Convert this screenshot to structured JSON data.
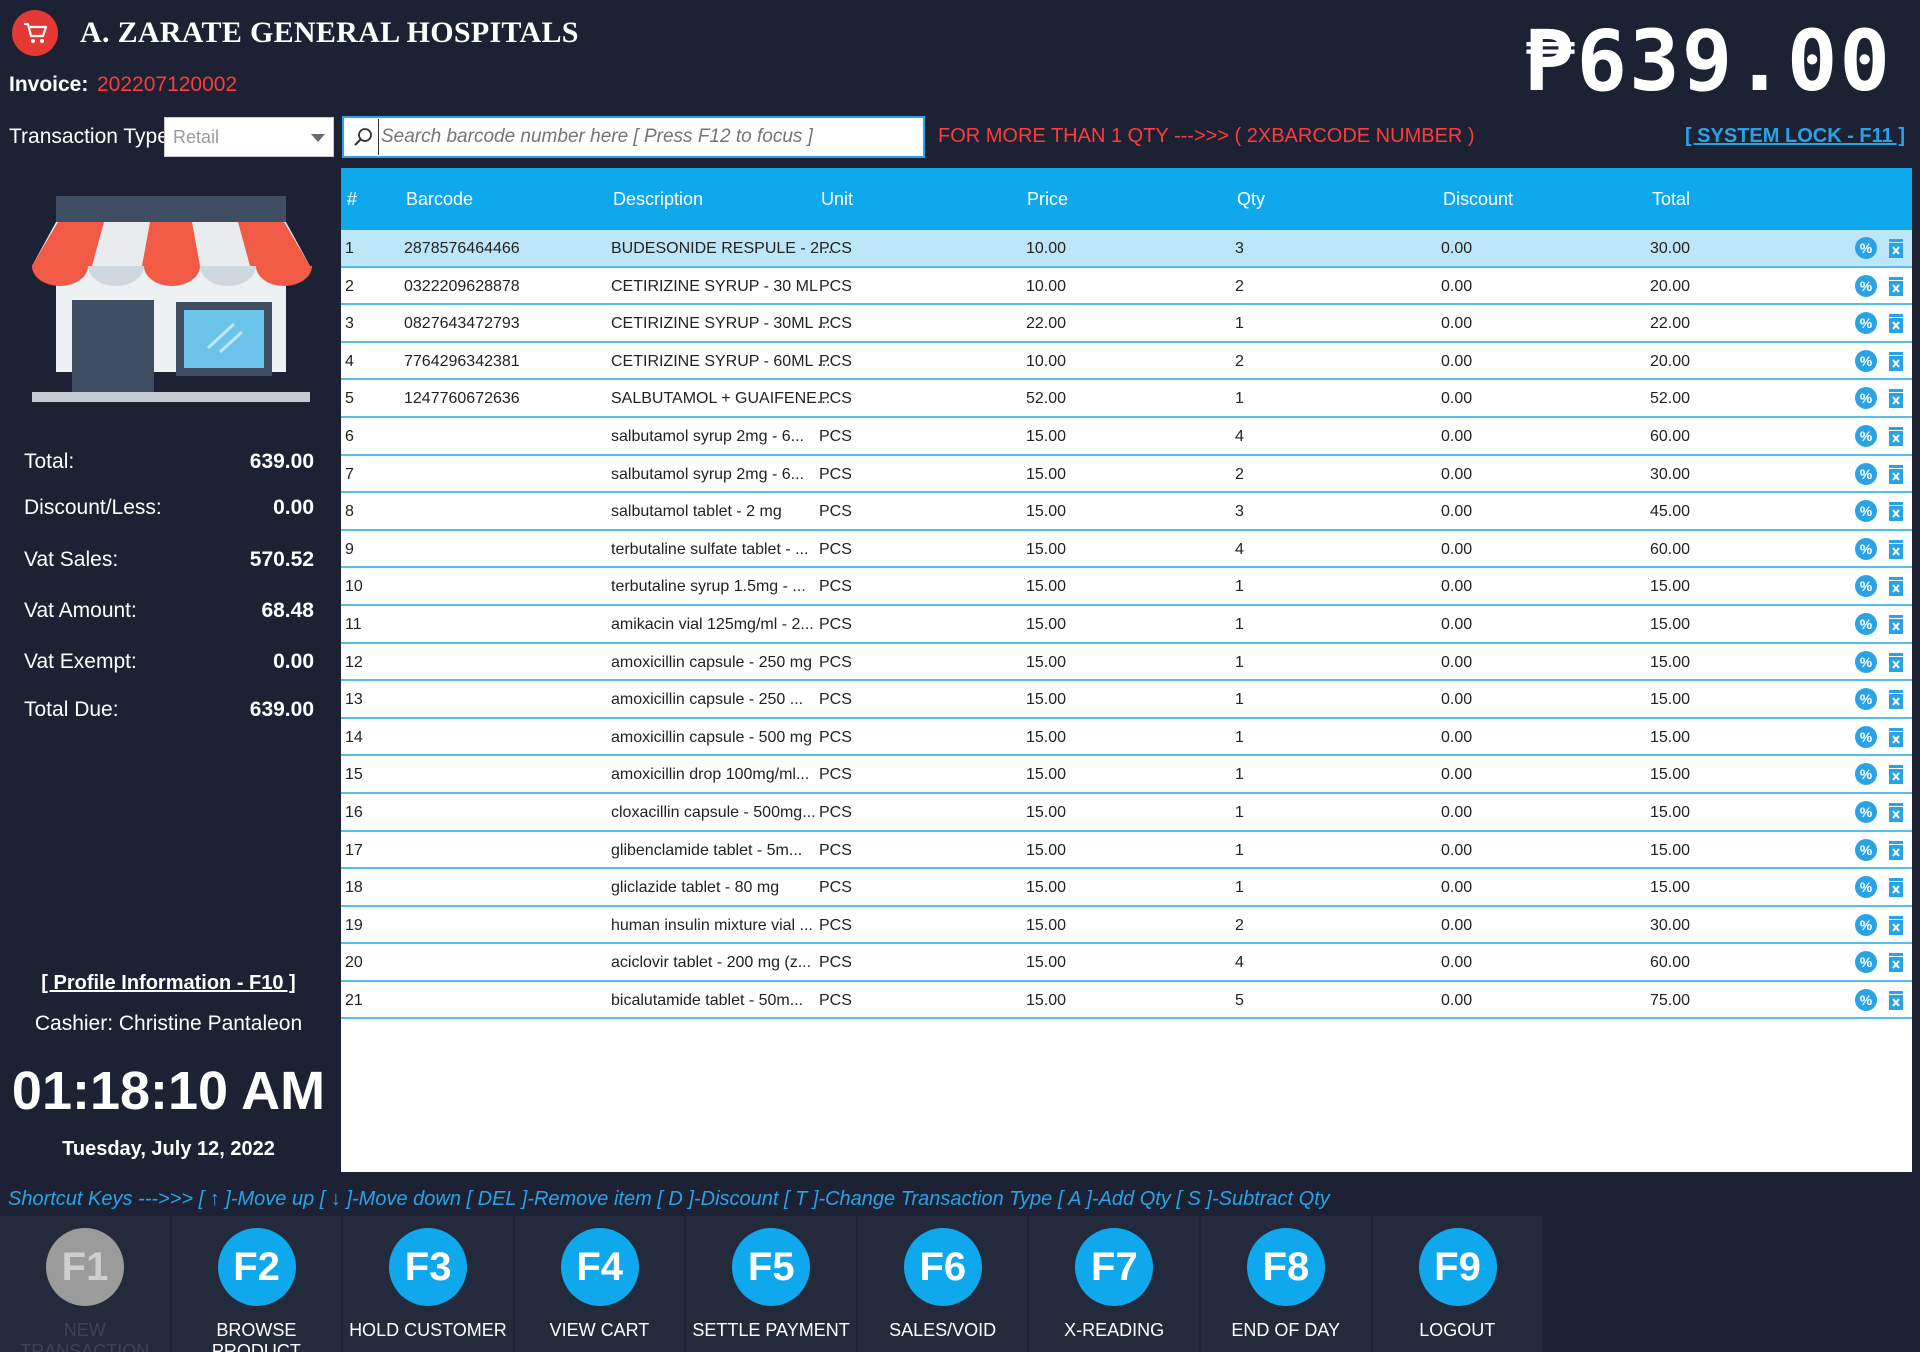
{
  "header": {
    "hospital_name": "A. ZARATE GENERAL HOSPITALS",
    "invoice_label": "Invoice:",
    "invoice_number": "202207120002",
    "big_total": "₱639.00",
    "transaction_type_label": "Transaction Type:",
    "transaction_type_value": "Retail",
    "search_placeholder": "Search barcode number here [ Press F12 to focus ]",
    "qty_hint": "FOR MORE THAN 1 QTY --->>> ( 2XBARCODE NUMBER )",
    "system_lock": "[ SYSTEM LOCK - F11 ]"
  },
  "summary": [
    {
      "label": "Total:",
      "value": "639.00"
    },
    {
      "label": "Discount/Less:",
      "value": "0.00"
    },
    {
      "label": "Vat Sales:",
      "value": "570.52"
    },
    {
      "label": "Vat Amount:",
      "value": "68.48"
    },
    {
      "label": "Vat Exempt:",
      "value": "0.00"
    },
    {
      "label": "Total Due:",
      "value": "639.00"
    }
  ],
  "profile": {
    "link": "[ Profile Information - F10 ]",
    "cashier": "Cashier: Christine Pantaleon",
    "time": "01:18:10 AM",
    "date": "Tuesday, July 12, 2022"
  },
  "table": {
    "columns": [
      "#",
      "Barcode",
      "Description",
      "Unit",
      "Price",
      "Qty",
      "Discount",
      "Total"
    ],
    "rows": [
      [
        "1",
        "2878576464466",
        "BUDESONIDE RESPULE - 2...",
        "PCS",
        "10.00",
        "3",
        "0.00",
        "30.00"
      ],
      [
        "2",
        "0322209628878",
        "CETIRIZINE SYRUP - 30 ML",
        "PCS",
        "10.00",
        "2",
        "0.00",
        "20.00"
      ],
      [
        "3",
        "0827643472793",
        "CETIRIZINE SYRUP - 30ML ...",
        "PCS",
        "22.00",
        "1",
        "0.00",
        "22.00"
      ],
      [
        "4",
        "7764296342381",
        "CETIRIZINE SYRUP - 60ML ...",
        "PCS",
        "10.00",
        "2",
        "0.00",
        "20.00"
      ],
      [
        "5",
        "1247760672636",
        "SALBUTAMOL + GUAIFENE...",
        "PCS",
        "52.00",
        "1",
        "0.00",
        "52.00"
      ],
      [
        "6",
        "",
        "salbutamol syrup 2mg - 6...",
        "PCS",
        "15.00",
        "4",
        "0.00",
        "60.00"
      ],
      [
        "7",
        "",
        "salbutamol syrup 2mg - 6...",
        "PCS",
        "15.00",
        "2",
        "0.00",
        "30.00"
      ],
      [
        "8",
        "",
        "salbutamol tablet - 2 mg",
        "PCS",
        "15.00",
        "3",
        "0.00",
        "45.00"
      ],
      [
        "9",
        "",
        "terbutaline sulfate tablet - ...",
        "PCS",
        "15.00",
        "4",
        "0.00",
        "60.00"
      ],
      [
        "10",
        "",
        "terbutaline syrup 1.5mg - ...",
        "PCS",
        "15.00",
        "1",
        "0.00",
        "15.00"
      ],
      [
        "11",
        "",
        "amikacin vial 125mg/ml - 2...",
        "PCS",
        "15.00",
        "1",
        "0.00",
        "15.00"
      ],
      [
        "12",
        "",
        "amoxicillin capsule - 250 mg",
        "PCS",
        "15.00",
        "1",
        "0.00",
        "15.00"
      ],
      [
        "13",
        "",
        "amoxicillin capsule - 250 ...",
        "PCS",
        "15.00",
        "1",
        "0.00",
        "15.00"
      ],
      [
        "14",
        "",
        "amoxicillin capsule - 500 mg",
        "PCS",
        "15.00",
        "1",
        "0.00",
        "15.00"
      ],
      [
        "15",
        "",
        "amoxicillin drop 100mg/ml...",
        "PCS",
        "15.00",
        "1",
        "0.00",
        "15.00"
      ],
      [
        "16",
        "",
        "cloxacillin capsule - 500mg...",
        "PCS",
        "15.00",
        "1",
        "0.00",
        "15.00"
      ],
      [
        "17",
        "",
        "glibenclamide tablet - 5m...",
        "PCS",
        "15.00",
        "1",
        "0.00",
        "15.00"
      ],
      [
        "18",
        "",
        "gliclazide tablet - 80 mg",
        "PCS",
        "15.00",
        "1",
        "0.00",
        "15.00"
      ],
      [
        "19",
        "",
        "human insulin mixture vial ...",
        "PCS",
        "15.00",
        "2",
        "0.00",
        "30.00"
      ],
      [
        "20",
        "",
        "aciclovir tablet - 200 mg (z...",
        "PCS",
        "15.00",
        "4",
        "0.00",
        "60.00"
      ],
      [
        "21",
        "",
        "bicalutamide tablet - 50m...",
        "PCS",
        "15.00",
        "5",
        "0.00",
        "75.00"
      ]
    ]
  },
  "shortcuts_text": "Shortcut Keys --->>> [ ↑ ]-Move up [ ↓ ]-Move down  [ DEL ]-Remove item [ D ]-Discount [ T ]-Change Transaction Type [ A ]-Add Qty [ S ]-Subtract Qty",
  "function_keys": [
    {
      "key": "F1",
      "label": "NEW TRANSACTION",
      "disabled": true
    },
    {
      "key": "F2",
      "label": "BROWSE PRODUCT",
      "disabled": false
    },
    {
      "key": "F3",
      "label": "HOLD CUSTOMER",
      "disabled": false
    },
    {
      "key": "F4",
      "label": "VIEW CART",
      "disabled": false
    },
    {
      "key": "F5",
      "label": "SETTLE PAYMENT",
      "disabled": false
    },
    {
      "key": "F6",
      "label": "SALES/VOID",
      "disabled": false
    },
    {
      "key": "F7",
      "label": "X-READING",
      "disabled": false
    },
    {
      "key": "F8",
      "label": "END OF DAY",
      "disabled": false
    },
    {
      "key": "F9",
      "label": "LOGOUT",
      "disabled": false
    }
  ],
  "icons": {
    "logo": "shopping-cart-icon",
    "store": "store-front-icon",
    "search": "search-icon",
    "discount": "percent-badge-icon",
    "remove": "trash-icon"
  },
  "colors": {
    "background": "#1c2233",
    "accent": "#0fa8ec",
    "alert": "#ff3b3b",
    "selected_row": "#bde6f8",
    "disabled_key": "#9b9b9b"
  }
}
